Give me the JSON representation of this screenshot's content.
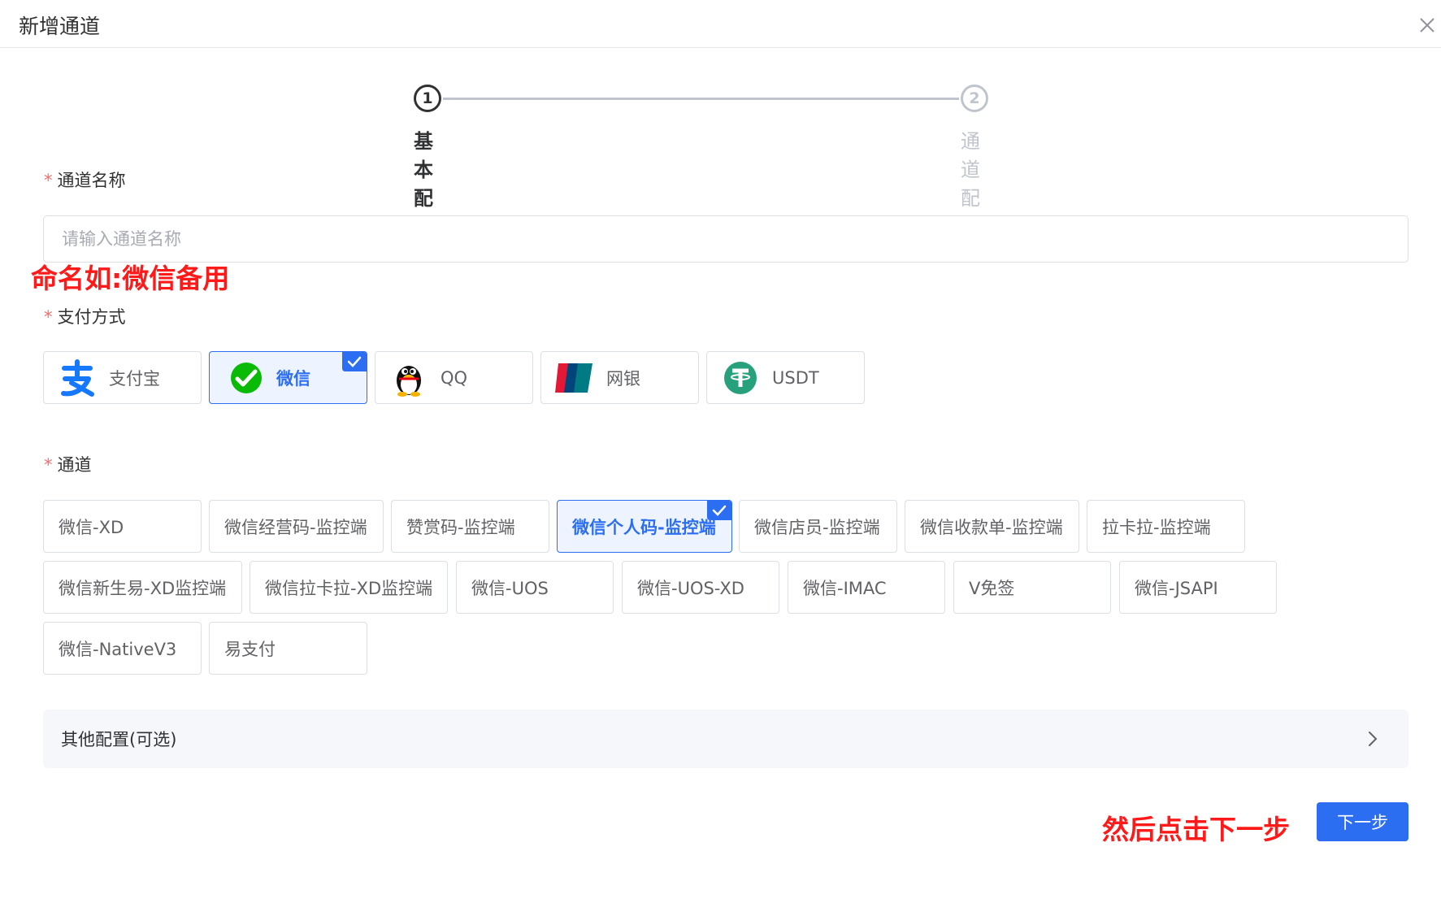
{
  "dialog": {
    "title": "新增通道",
    "close_icon": "close-icon"
  },
  "steps": [
    {
      "number": "1",
      "title": "基本配置",
      "state": "active"
    },
    {
      "number": "2",
      "title": "通道配置",
      "state": "wait"
    }
  ],
  "form": {
    "name": {
      "required_mark": "*",
      "label": "通道名称",
      "value": "",
      "placeholder": "请输入通道名称"
    },
    "payment": {
      "required_mark": "*",
      "label": "支付方式",
      "options": [
        {
          "label": "支付宝",
          "icon": "alipay-icon",
          "selected": false
        },
        {
          "label": "微信",
          "icon": "wechat-icon",
          "selected": true
        },
        {
          "label": "QQ",
          "icon": "qq-penguin-icon",
          "selected": false
        },
        {
          "label": "网银",
          "icon": "unionpay-icon",
          "selected": false
        },
        {
          "label": "USDT",
          "icon": "tether-icon",
          "selected": false
        }
      ]
    },
    "channel": {
      "required_mark": "*",
      "label": "通道",
      "options": [
        {
          "label": "微信-XD",
          "selected": false
        },
        {
          "label": "微信经营码-监控端",
          "selected": false
        },
        {
          "label": "赞赏码-监控端",
          "selected": false
        },
        {
          "label": "微信个人码-监控端",
          "selected": true
        },
        {
          "label": "微信店员-监控端",
          "selected": false
        },
        {
          "label": "微信收款单-监控端",
          "selected": false
        },
        {
          "label": "拉卡拉-监控端",
          "selected": false
        },
        {
          "label": "微信新生易-XD监控端",
          "selected": false
        },
        {
          "label": "微信拉卡拉-XD监控端",
          "selected": false
        },
        {
          "label": "微信-UOS",
          "selected": false
        },
        {
          "label": "微信-UOS-XD",
          "selected": false
        },
        {
          "label": "微信-IMAC",
          "selected": false
        },
        {
          "label": "V免签",
          "selected": false
        },
        {
          "label": "微信-JSAPI",
          "selected": false
        },
        {
          "label": "微信-NativeV3",
          "selected": false
        },
        {
          "label": "易支付",
          "selected": false
        }
      ]
    },
    "other_config": {
      "label": "其他配置(可选)",
      "icon": "chevron-right-icon"
    }
  },
  "annotations": {
    "name_hint": "命名如:微信备用",
    "next_hint": "然后点击下一步"
  },
  "footer": {
    "next_label": "下一步"
  },
  "colors": {
    "accent": "#2c6ef2",
    "selected_bg": "#eef4ff",
    "required": "#f56c6c",
    "annotation": "#ff1a1a",
    "wechat_green": "#09bb07",
    "alipay_blue": "#1677ff",
    "usdt_green": "#26a17b"
  }
}
